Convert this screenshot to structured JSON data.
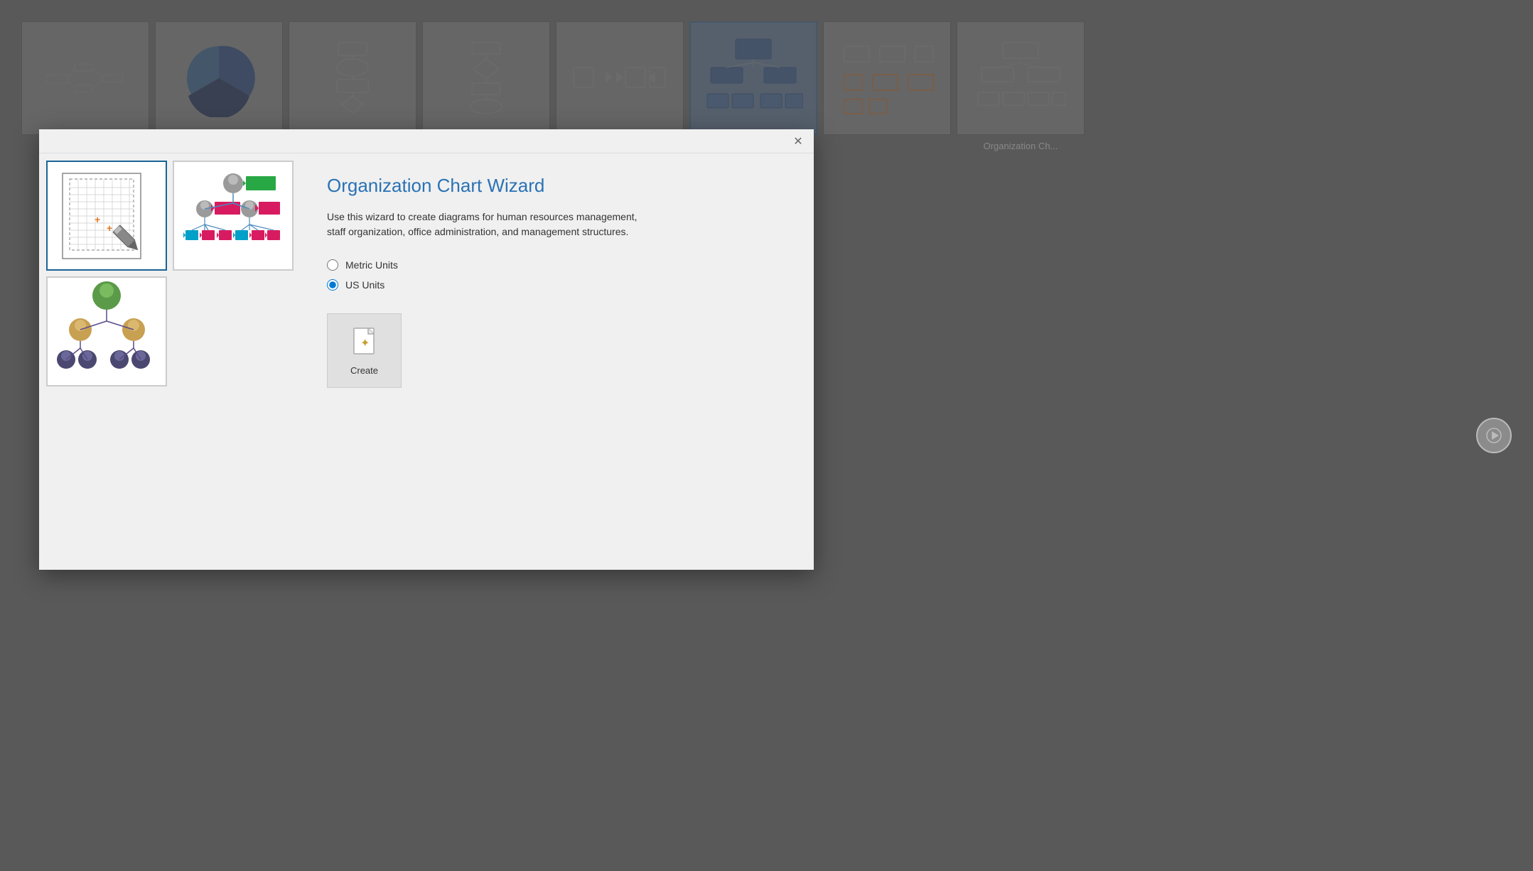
{
  "background": {
    "thumbnails": [
      {
        "id": "flowchart",
        "label": ""
      },
      {
        "id": "pie",
        "label": ""
      },
      {
        "id": "process",
        "label": ""
      },
      {
        "id": "flowchart2",
        "label": ""
      },
      {
        "id": "data-flow",
        "label": ""
      },
      {
        "id": "org-chart-selected",
        "label": "..."
      },
      {
        "id": "network",
        "label": ""
      },
      {
        "id": "org-chart2",
        "label": "Organization Ch..."
      }
    ]
  },
  "dialog": {
    "title": "Organization Chart Wizard",
    "description": "Use this wizard to create diagrams for human resources management, staff organization, office administration, and management structures.",
    "units": {
      "metric_label": "Metric Units",
      "us_label": "US Units",
      "selected": "us"
    },
    "create_button_label": "Create",
    "close_label": "✕"
  }
}
